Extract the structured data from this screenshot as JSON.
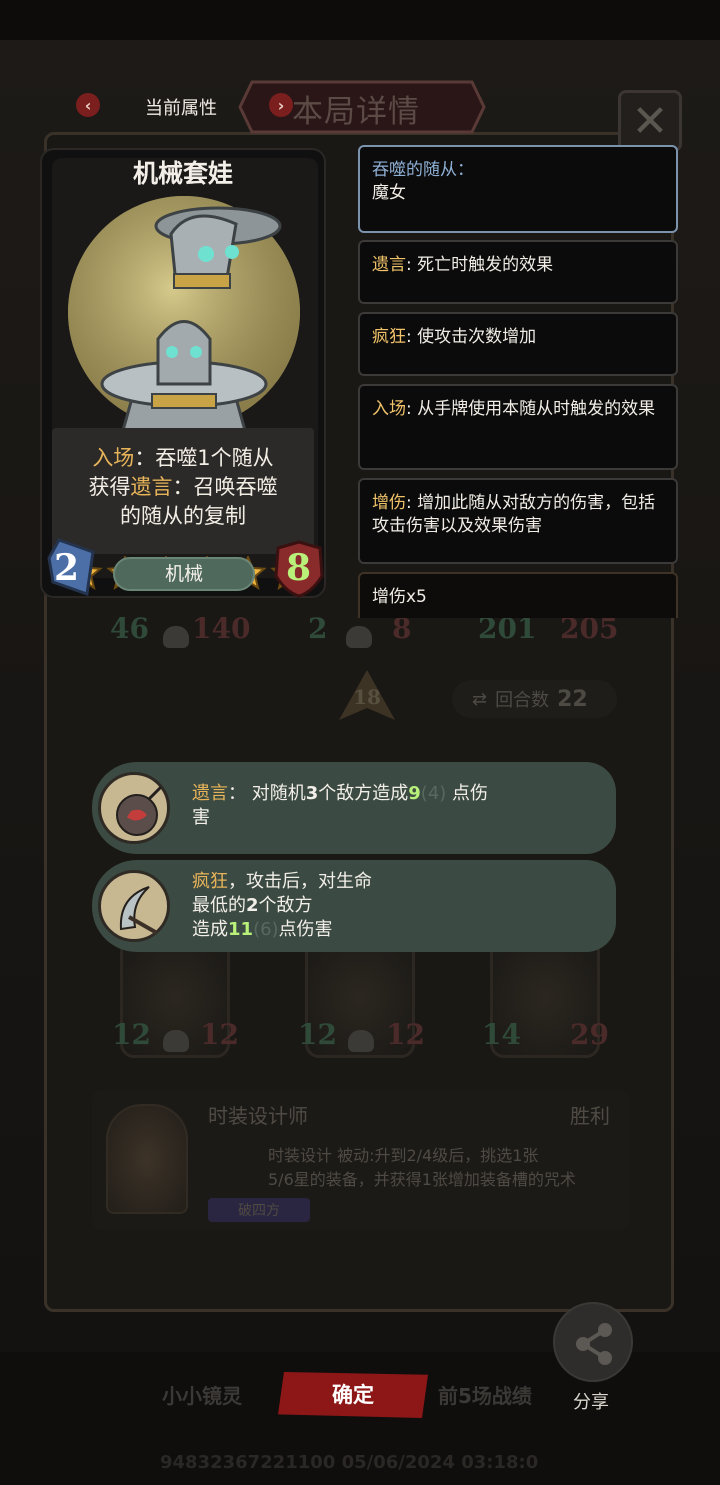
{
  "header": {
    "back_label": "当前属性",
    "title": "本局详情",
    "close_glyph": "✕"
  },
  "card": {
    "name": "机械套娃",
    "stars": 6,
    "desc_line1_kw": "入场",
    "desc_line1_rest": "：吞噬1个随从",
    "desc_line2_pre": "获得",
    "desc_line2_kw": "遗言",
    "desc_line2_rest": "：召唤吞噬",
    "desc_line3": "的随从的复制",
    "cost": "2",
    "tribe": "机械",
    "attack": "8"
  },
  "keywords": [
    {
      "key": "吞噬的随从：",
      "text": "魔女"
    },
    {
      "key": "遗言",
      "text": ": 死亡时触发的效果"
    },
    {
      "key": "疯狂",
      "text": ": 使攻击次数增加"
    },
    {
      "key": "入场",
      "text": ": 从手牌使用本随从时触发的效果"
    },
    {
      "key": "增伤",
      "text": ": 增加此随从对敌方的伤害，包括攻击伤害以及效果伤害"
    },
    {
      "key": "",
      "text": "增伤x5"
    }
  ],
  "tooltips": [
    {
      "kw": "遗言",
      "t1": "：  对随机",
      "n1": "3",
      "t2": "个敌方造成",
      "n2": "9",
      "ghost": "(4)",
      "t3": " 点伤",
      "t4": "害"
    },
    {
      "kw": "疯狂",
      "t1": "，攻击后，对生命",
      "t2": "最低的",
      "n1": "2",
      "t3": "个敌方",
      "t4": "造成",
      "n2": "11",
      "ghost": "(6)",
      "t5": "点伤害"
    }
  ],
  "board": {
    "row1": [
      {
        "atk": "46",
        "hp": "140"
      },
      {
        "atk": "2",
        "hp": "8"
      },
      {
        "atk": "201",
        "hp": "205"
      }
    ],
    "row3": [
      {
        "atk": "12",
        "hp": "12"
      },
      {
        "atk": "12",
        "hp": "12"
      },
      {
        "atk": "14",
        "hp": "29"
      }
    ],
    "turn_marker": "18",
    "turn_label": "回合数",
    "turn_count": "22"
  },
  "hero": {
    "name": "时装设计师",
    "result": "胜利",
    "skill": "时装设计 被动:升到2/4级后，挑选1张",
    "skill2": "5/6星的装备，并获得1张增加装备槽的咒术",
    "tag": "破四方"
  },
  "bottom": {
    "tab_left": "小小镜灵",
    "confirm": "确定",
    "tab_right": "前5场战绩",
    "share": "分享",
    "footer_id": "94832367221100 05/06/2024 03:18:0"
  },
  "colors": {
    "accent_red": "#8d1717",
    "keyword_gold": "#e8b45a",
    "value_green": "#b9f07a",
    "devoured_blue": "#8fb0d6",
    "tooltip_bg": "#3b4a42"
  }
}
